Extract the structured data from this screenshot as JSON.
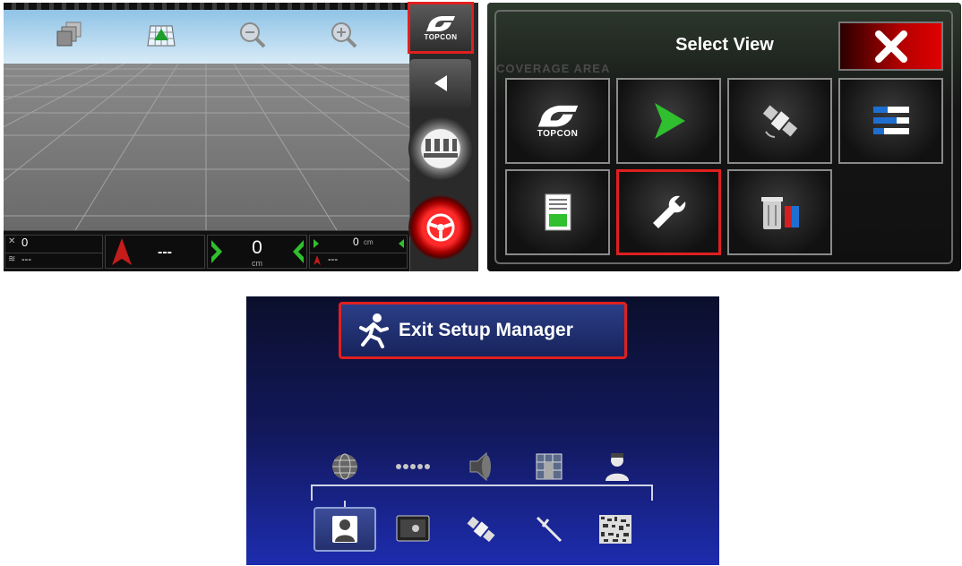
{
  "guidance_screen": {
    "toolbar_icons": [
      "3d-view-icon",
      "field-view-icon",
      "zoom-out-icon",
      "zoom-in-icon"
    ],
    "status_bar": {
      "satellites": "0",
      "signal": "---",
      "heading": "---",
      "offset_value": "0",
      "offset_unit": "cm",
      "tile_value": "0",
      "tile_unit": "cm",
      "tile_secondary": "---"
    },
    "sidebar": {
      "brand": "TOPCON",
      "buttons": [
        "collapse-arrow-icon",
        "implement-sections-icon",
        "autosteer-wheel-icon"
      ]
    }
  },
  "select_view": {
    "title": "Select View",
    "background_label": "COVERAGE AREA",
    "close_label": "close",
    "tiles": [
      {
        "name": "TOPCON",
        "icon": "topcon-logo-icon"
      },
      {
        "name": "guidance",
        "icon": "green-arrow-icon"
      },
      {
        "name": "gnss",
        "icon": "satellite-icon"
      },
      {
        "name": "mini-view",
        "icon": "bars-icon"
      },
      {
        "name": "data",
        "icon": "document-icon"
      },
      {
        "name": "setup",
        "icon": "wrench-icon",
        "selected": true
      },
      {
        "name": "storage",
        "icon": "trash-usb-icon"
      }
    ]
  },
  "setup_manager": {
    "exit_label": "Exit Setup Manager",
    "top_row": [
      "globe-icon",
      "dots-icon",
      "speaker-icon",
      "grid-icon",
      "operator-icon"
    ],
    "bottom_row": [
      "user-icon",
      "console-icon",
      "satellite-icon",
      "implement-icon",
      "texture-icon"
    ],
    "selected": "user-icon"
  },
  "colors": {
    "highlight": "#e01f1f",
    "guidance_green": "#2fbf2f",
    "setup_blue": "#12185a"
  }
}
